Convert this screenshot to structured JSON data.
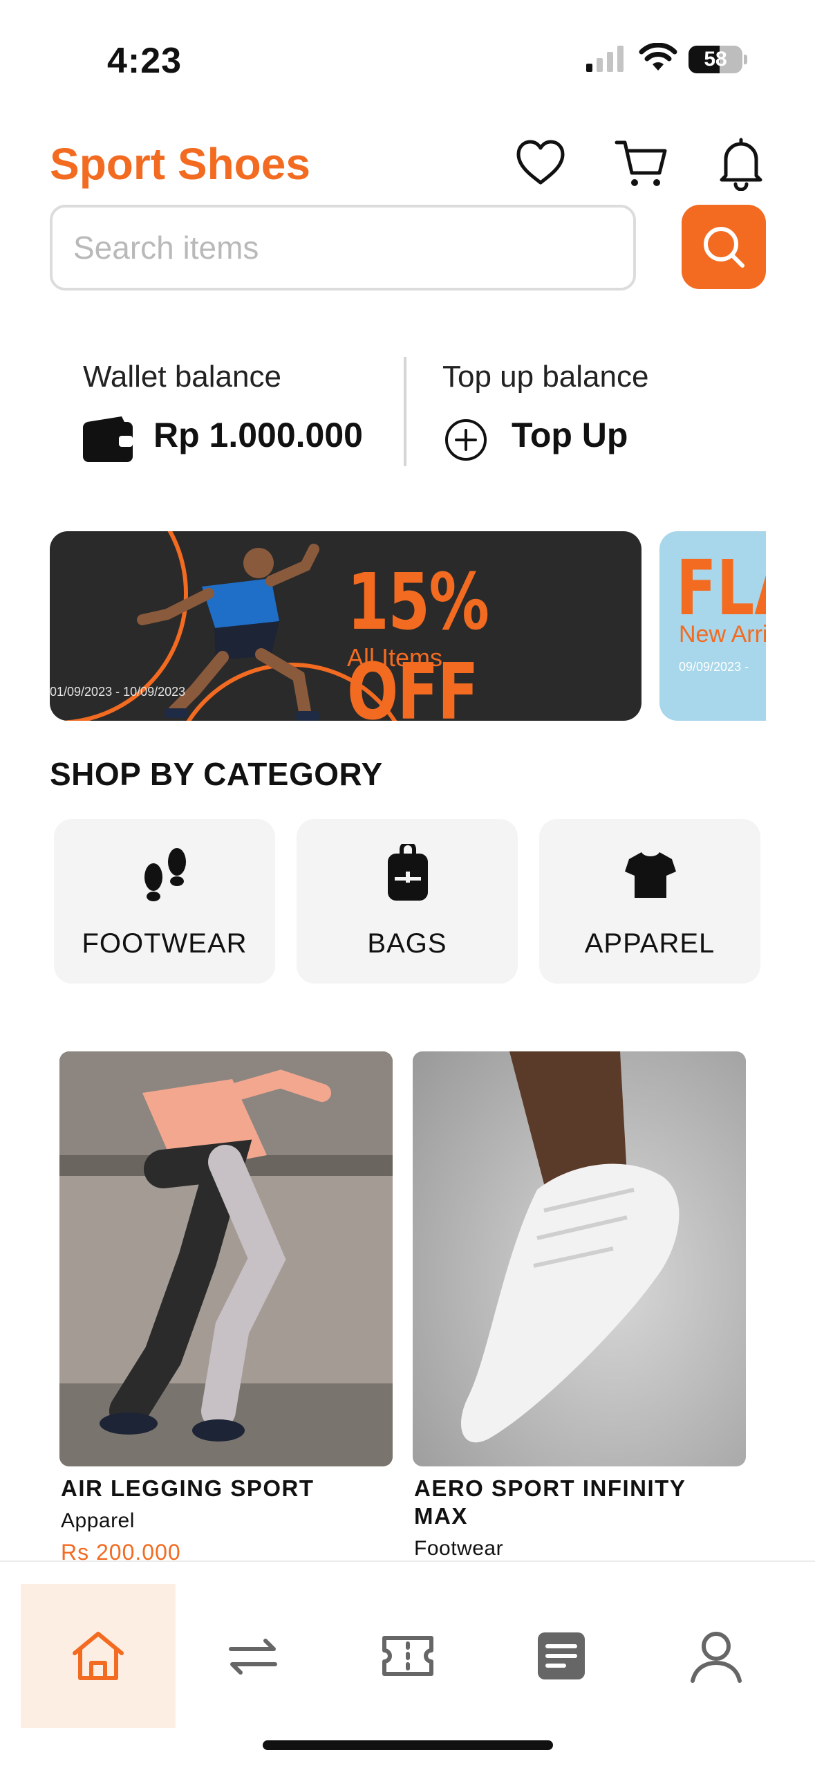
{
  "status_bar": {
    "time": "4:23",
    "battery": "58",
    "battery_level": 0.58
  },
  "header": {
    "title": "Sport Shoes",
    "icons": [
      "heart-icon",
      "cart-icon",
      "bell-icon"
    ]
  },
  "search": {
    "placeholder": "Search items",
    "value": ""
  },
  "wallet": {
    "label": "Wallet balance",
    "amount": "Rp 1.000.000",
    "topup_label": "Top up balance",
    "topup_action": "Top Up"
  },
  "banners": [
    {
      "headline": "15% OFF",
      "subtitle": "All Items",
      "dates": "01/09/2023 -  10/09/2023"
    },
    {
      "headline": "FLA",
      "subtitle": "New Arri",
      "dates": "09/09/2023 -"
    }
  ],
  "categories": {
    "title": "SHOP BY CATEGORY",
    "items": [
      {
        "label": "FOOTWEAR",
        "icon": "footprints-icon"
      },
      {
        "label": "BAGS",
        "icon": "backpack-icon"
      },
      {
        "label": "APPAREL",
        "icon": "tshirt-icon"
      }
    ]
  },
  "products": [
    {
      "name": "AIR LEGGING SPORT",
      "category": "Apparel",
      "price": "Rs 200.000"
    },
    {
      "name": "AERO SPORT INFINITY MAX",
      "category": "Footwear"
    }
  ],
  "bottom_nav": {
    "items": [
      "home-icon",
      "transfer-icon",
      "voucher-icon",
      "orders-icon",
      "profile-icon"
    ],
    "active": "home-icon"
  },
  "colors": {
    "accent": "#f26b21",
    "active_bg": "#fdeee3",
    "card_bg": "#f4f4f4"
  }
}
